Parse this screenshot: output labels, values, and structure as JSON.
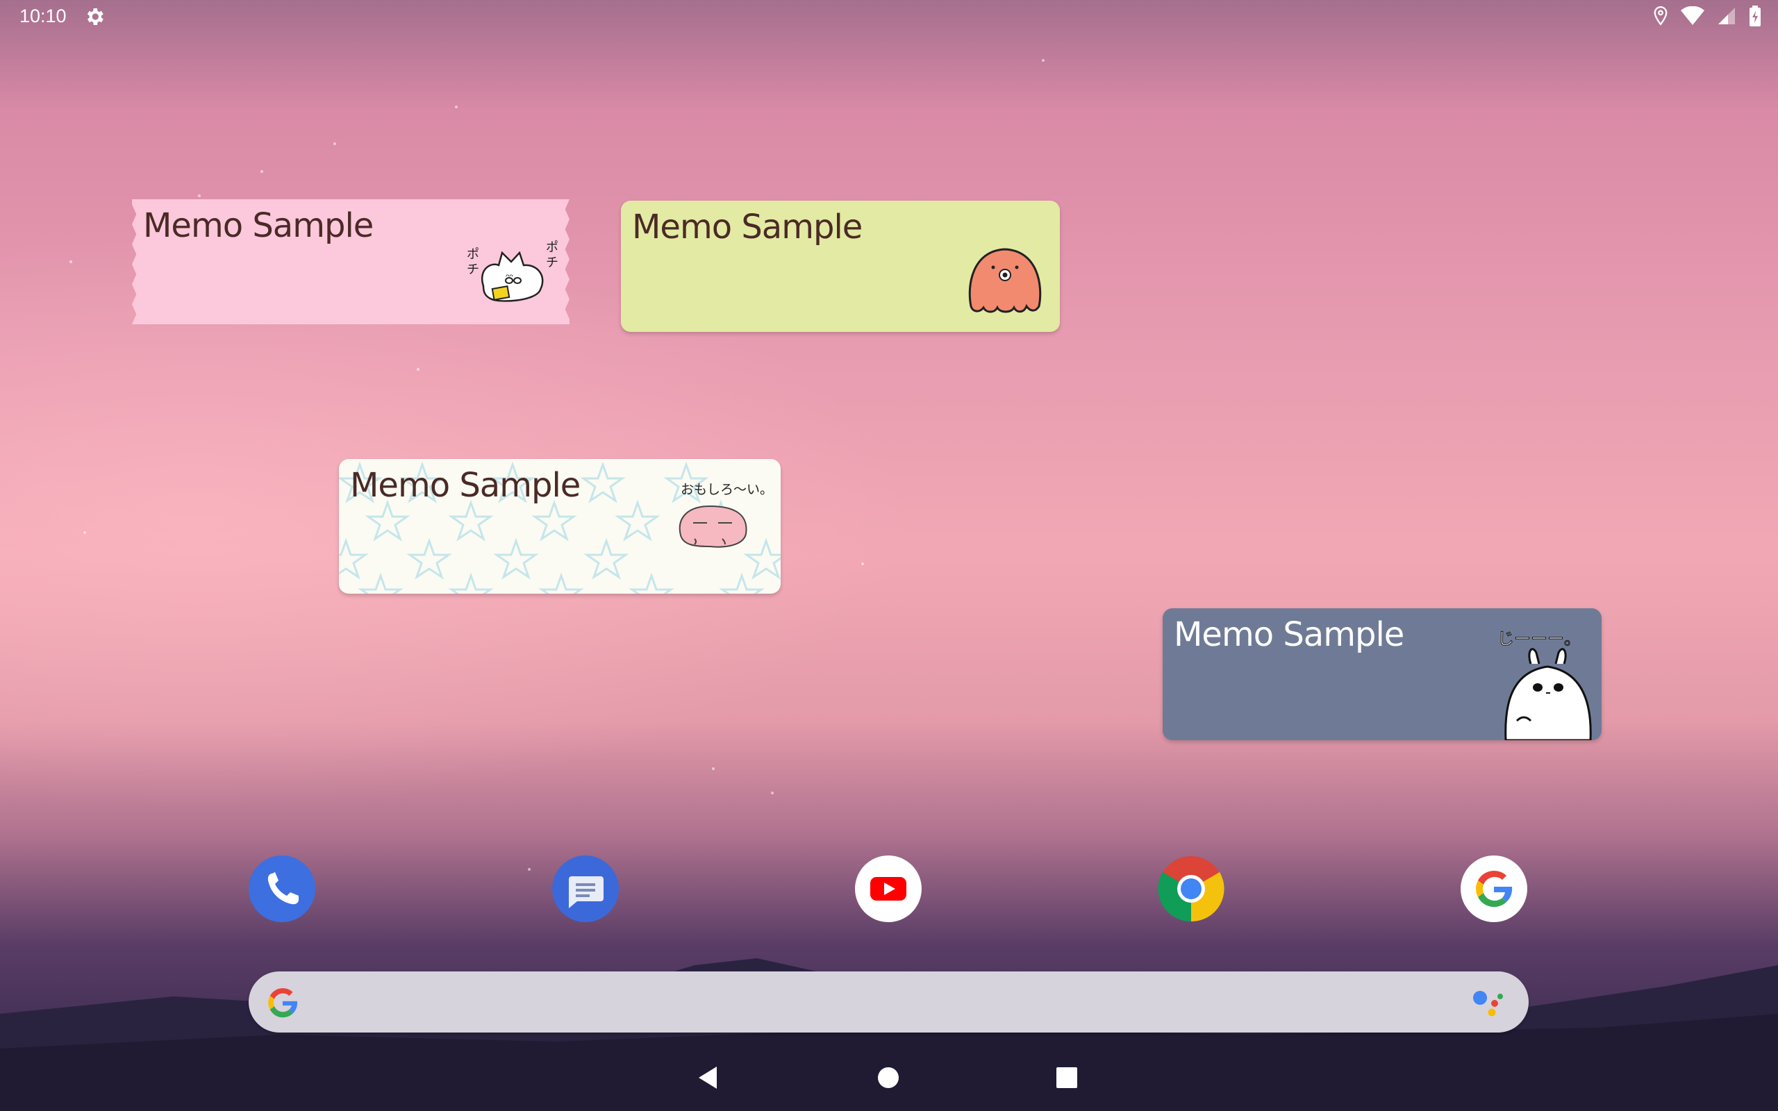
{
  "status_bar": {
    "time": "10:10"
  },
  "widgets": [
    {
      "title": "Memo Sample",
      "style": "pink-tape",
      "sticker": "cat-sticker",
      "sticker_text": "ポチ ポチ"
    },
    {
      "title": "Memo Sample",
      "style": "lime-green",
      "sticker": "octopus-sticker"
    },
    {
      "title": "Memo Sample",
      "style": "star-pattern",
      "sticker": "axolotl-sticker",
      "sticker_text": "おもしろ〜い。"
    },
    {
      "title": "Memo Sample",
      "style": "slate-blue",
      "sticker": "rabbit-sticker",
      "sticker_text": "じーーー。"
    }
  ],
  "dock": [
    {
      "app": "Phone",
      "icon": "phone-icon"
    },
    {
      "app": "Messages",
      "icon": "messages-icon"
    },
    {
      "app": "YouTube",
      "icon": "youtube-icon"
    },
    {
      "app": "Chrome",
      "icon": "chrome-icon"
    },
    {
      "app": "Google",
      "icon": "google-icon"
    }
  ],
  "colors": {
    "memo_pink": "#fcc8dc",
    "memo_lime": "#e3eaa3",
    "memo_cream": "#fbfbf3",
    "memo_slate": "#6f7b96",
    "memo_text": "#4a2a26"
  }
}
